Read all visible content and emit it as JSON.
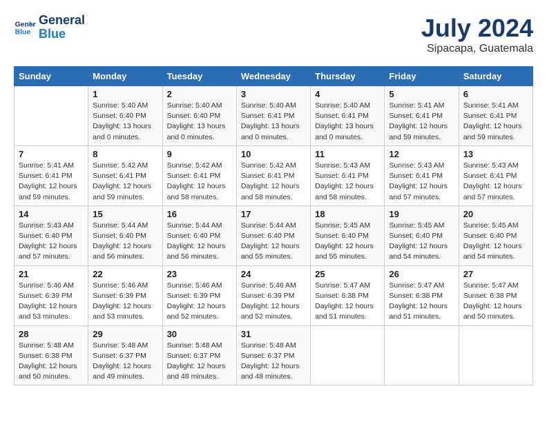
{
  "header": {
    "logo_line1": "General",
    "logo_line2": "Blue",
    "title": "July 2024",
    "location": "Sipacapa, Guatemala"
  },
  "columns": [
    "Sunday",
    "Monday",
    "Tuesday",
    "Wednesday",
    "Thursday",
    "Friday",
    "Saturday"
  ],
  "weeks": [
    [
      {
        "day": "",
        "detail": ""
      },
      {
        "day": "1",
        "detail": "Sunrise: 5:40 AM\nSunset: 6:40 PM\nDaylight: 13 hours\nand 0 minutes."
      },
      {
        "day": "2",
        "detail": "Sunrise: 5:40 AM\nSunset: 6:40 PM\nDaylight: 13 hours\nand 0 minutes."
      },
      {
        "day": "3",
        "detail": "Sunrise: 5:40 AM\nSunset: 6:41 PM\nDaylight: 13 hours\nand 0 minutes."
      },
      {
        "day": "4",
        "detail": "Sunrise: 5:40 AM\nSunset: 6:41 PM\nDaylight: 13 hours\nand 0 minutes."
      },
      {
        "day": "5",
        "detail": "Sunrise: 5:41 AM\nSunset: 6:41 PM\nDaylight: 12 hours\nand 59 minutes."
      },
      {
        "day": "6",
        "detail": "Sunrise: 5:41 AM\nSunset: 6:41 PM\nDaylight: 12 hours\nand 59 minutes."
      }
    ],
    [
      {
        "day": "7",
        "detail": "Sunrise: 5:41 AM\nSunset: 6:41 PM\nDaylight: 12 hours\nand 59 minutes."
      },
      {
        "day": "8",
        "detail": "Sunrise: 5:42 AM\nSunset: 6:41 PM\nDaylight: 12 hours\nand 59 minutes."
      },
      {
        "day": "9",
        "detail": "Sunrise: 5:42 AM\nSunset: 6:41 PM\nDaylight: 12 hours\nand 58 minutes."
      },
      {
        "day": "10",
        "detail": "Sunrise: 5:42 AM\nSunset: 6:41 PM\nDaylight: 12 hours\nand 58 minutes."
      },
      {
        "day": "11",
        "detail": "Sunrise: 5:43 AM\nSunset: 6:41 PM\nDaylight: 12 hours\nand 58 minutes."
      },
      {
        "day": "12",
        "detail": "Sunrise: 5:43 AM\nSunset: 6:41 PM\nDaylight: 12 hours\nand 57 minutes."
      },
      {
        "day": "13",
        "detail": "Sunrise: 5:43 AM\nSunset: 6:41 PM\nDaylight: 12 hours\nand 57 minutes."
      }
    ],
    [
      {
        "day": "14",
        "detail": "Sunrise: 5:43 AM\nSunset: 6:40 PM\nDaylight: 12 hours\nand 57 minutes."
      },
      {
        "day": "15",
        "detail": "Sunrise: 5:44 AM\nSunset: 6:40 PM\nDaylight: 12 hours\nand 56 minutes."
      },
      {
        "day": "16",
        "detail": "Sunrise: 5:44 AM\nSunset: 6:40 PM\nDaylight: 12 hours\nand 56 minutes."
      },
      {
        "day": "17",
        "detail": "Sunrise: 5:44 AM\nSunset: 6:40 PM\nDaylight: 12 hours\nand 55 minutes."
      },
      {
        "day": "18",
        "detail": "Sunrise: 5:45 AM\nSunset: 6:40 PM\nDaylight: 12 hours\nand 55 minutes."
      },
      {
        "day": "19",
        "detail": "Sunrise: 5:45 AM\nSunset: 6:40 PM\nDaylight: 12 hours\nand 54 minutes."
      },
      {
        "day": "20",
        "detail": "Sunrise: 5:45 AM\nSunset: 6:40 PM\nDaylight: 12 hours\nand 54 minutes."
      }
    ],
    [
      {
        "day": "21",
        "detail": "Sunrise: 5:46 AM\nSunset: 6:39 PM\nDaylight: 12 hours\nand 53 minutes."
      },
      {
        "day": "22",
        "detail": "Sunrise: 5:46 AM\nSunset: 6:39 PM\nDaylight: 12 hours\nand 53 minutes."
      },
      {
        "day": "23",
        "detail": "Sunrise: 5:46 AM\nSunset: 6:39 PM\nDaylight: 12 hours\nand 52 minutes."
      },
      {
        "day": "24",
        "detail": "Sunrise: 5:46 AM\nSunset: 6:39 PM\nDaylight: 12 hours\nand 52 minutes."
      },
      {
        "day": "25",
        "detail": "Sunrise: 5:47 AM\nSunset: 6:38 PM\nDaylight: 12 hours\nand 51 minutes."
      },
      {
        "day": "26",
        "detail": "Sunrise: 5:47 AM\nSunset: 6:38 PM\nDaylight: 12 hours\nand 51 minutes."
      },
      {
        "day": "27",
        "detail": "Sunrise: 5:47 AM\nSunset: 6:38 PM\nDaylight: 12 hours\nand 50 minutes."
      }
    ],
    [
      {
        "day": "28",
        "detail": "Sunrise: 5:48 AM\nSunset: 6:38 PM\nDaylight: 12 hours\nand 50 minutes."
      },
      {
        "day": "29",
        "detail": "Sunrise: 5:48 AM\nSunset: 6:37 PM\nDaylight: 12 hours\nand 49 minutes."
      },
      {
        "day": "30",
        "detail": "Sunrise: 5:48 AM\nSunset: 6:37 PM\nDaylight: 12 hours\nand 48 minutes."
      },
      {
        "day": "31",
        "detail": "Sunrise: 5:48 AM\nSunset: 6:37 PM\nDaylight: 12 hours\nand 48 minutes."
      },
      {
        "day": "",
        "detail": ""
      },
      {
        "day": "",
        "detail": ""
      },
      {
        "day": "",
        "detail": ""
      }
    ]
  ]
}
